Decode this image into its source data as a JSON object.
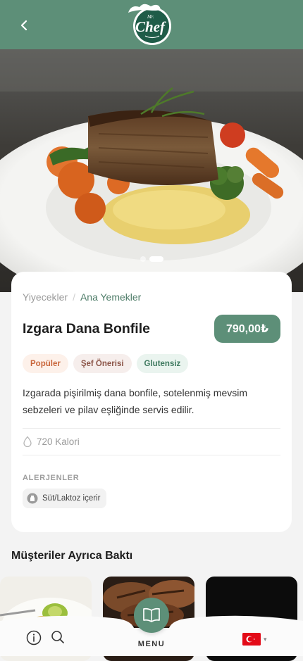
{
  "header": {
    "back_icon": "chevron-left-icon",
    "logo": {
      "small": "Mr.",
      "big": "Chef"
    },
    "colors": {
      "brand": "#5d8f78"
    }
  },
  "hero": {
    "image": "grilled-beef-fillet-plate",
    "carousel": {
      "count": 2,
      "active_index": 1
    }
  },
  "product": {
    "breadcrumb": [
      "Yiyecekler",
      "Ana Yemekler"
    ],
    "name": "Izgara Dana Bonfile",
    "price": "790,00₺",
    "tags": [
      "Popüler",
      "Şef Önerisi",
      "Glutensiz"
    ],
    "description": "Izgarada pişirilmiş dana bonfile, sotelenmiş mevsim sebzeleri ve pilav eşliğinde servis edilir.",
    "calories": "720 Kalori",
    "allergens_heading": "ALERJENLER",
    "allergens": [
      "Süt/Laktoz içerir"
    ]
  },
  "also_viewed": {
    "title": "Müşteriler Ayrıca Baktı",
    "items": [
      {
        "image": "avocado-dish-thumbnail"
      },
      {
        "image": "grilled-meat-thumbnail"
      },
      {
        "image": "fried-ball-thumbnail"
      }
    ]
  },
  "bottom_nav": {
    "info_icon": "info-icon",
    "search_icon": "search-icon",
    "menu_icon": "open-book-icon",
    "menu_label": "MENU",
    "language_flag": "turkey-flag-icon"
  }
}
